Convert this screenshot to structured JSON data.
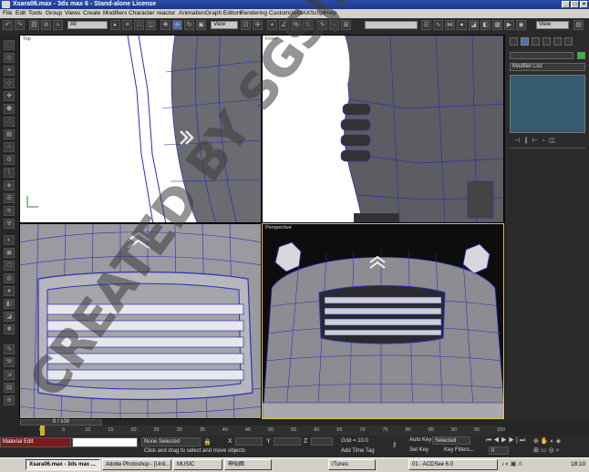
{
  "window": {
    "title": "Xsara06.max - 3ds max 6 - Stand-alone License",
    "min": "_",
    "max": "□",
    "close": "×"
  },
  "menu": [
    "File",
    "Edit",
    "Tools",
    "Group",
    "Views",
    "Create",
    "Modifiers",
    "Character",
    "reactor",
    "Animation",
    "Graph Editors",
    "Rendering",
    "Customize",
    "MAXScript",
    "Help"
  ],
  "toolbar": {
    "filter": "All",
    "refcoord": "View",
    "named_sel": "",
    "view_right": "View"
  },
  "viewports": {
    "top": "Top",
    "front": "Front",
    "left": "",
    "perspective": "Perspective"
  },
  "command_panel": {
    "name_field": "",
    "modifier_list": "Modifier List"
  },
  "timeline": {
    "frame_readout": "0 / 100",
    "ticks": [
      "0",
      "5",
      "10",
      "15",
      "20",
      "25",
      "30",
      "35",
      "40",
      "45",
      "50",
      "55",
      "60",
      "65",
      "70",
      "75",
      "80",
      "85",
      "90",
      "95",
      "100"
    ]
  },
  "status": {
    "maxscript": "Material Edit",
    "selection": "None Selected",
    "prompt": "Click and drag to select and move objects",
    "x_label": "X",
    "y_label": "Y",
    "z_label": "Z",
    "grid": "Grid = 10.0",
    "add_time_tag": "Add Time Tag",
    "auto_key": "Auto Key",
    "set_key": "Set Key",
    "selected": "Selected",
    "key_filters": "Key Filters...",
    "frame": "0"
  },
  "taskbar": {
    "tasks": [
      "Xsara06.max - 3ds max ...",
      "Adobe Photoshop - [Unti...",
      "MUSIC",
      "神仙图",
      "iTunes",
      "01 - ACDSee 6.0"
    ],
    "clock": "18:10"
  },
  "watermark": "CREATED BY SGSJH",
  "colors": {
    "wire": "#2d2fb4",
    "viewport_bg": "#ffffff",
    "persp_bg": "#0d0d0d"
  }
}
